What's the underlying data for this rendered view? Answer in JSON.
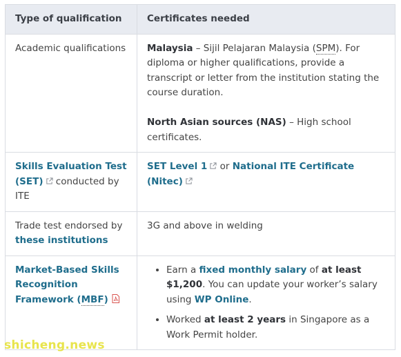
{
  "table": {
    "headers": [
      "Type of qualification",
      "Certificates needed"
    ],
    "row1": {
      "left": "Academic qualifications",
      "p1_bold": "Malaysia",
      "p1_text_a": " – Sijil Pelajaran Malaysia (",
      "p1_abbr": "SPM",
      "p1_text_b": "). For diploma or higher qualifications, provide a transcript or letter from the institution stating the course duration.",
      "p2_bold": "North Asian sources (NAS)",
      "p2_text": " – High school certificates."
    },
    "row2": {
      "left_link": "Skills Evaluation Test (SET)",
      "left_text": " conducted by ITE",
      "link1": "SET Level 1",
      "or_text": " or ",
      "link2": "National ITE Certificate (Nitec)"
    },
    "row3": {
      "left_text": "Trade test endorsed by ",
      "left_link": "these institutions",
      "right_text": "3G and above in welding"
    },
    "row4": {
      "left_link_a": "Market-Based Skills Recognition Framework (",
      "left_abbr": "MBF",
      "left_link_b": ")",
      "b1_a": "Earn a ",
      "b1_link": "fixed monthly salary",
      "b1_b": " of ",
      "b1_bold": "at least $1,200",
      "b1_c": ". You can update your worker’s salary using ",
      "b1_link2": "WP Online",
      "b1_d": ".",
      "b2_a": "Worked ",
      "b2_bold": "at least 2 years",
      "b2_b": " in Singapore as a Work Permit holder."
    }
  },
  "watermark": "shicheng.news",
  "colors": {
    "link": "#1f6d8c",
    "header_bg": "#e8ebf1",
    "border": "#d9dce2",
    "watermark": "#e6e23a"
  }
}
